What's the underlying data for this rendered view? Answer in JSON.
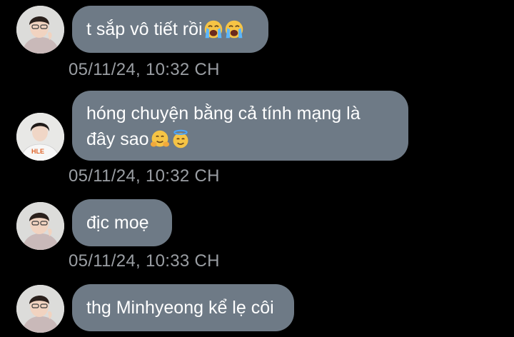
{
  "conversation": {
    "messages": [
      {
        "text": "t sắp vô tiết rồi",
        "emojis": [
          "loudly-crying-face-emoji",
          "loudly-crying-face-emoji"
        ],
        "timestamp": "05/11/24, 10:32 CH"
      },
      {
        "text_line1": "hóng chuyện bằng cả tính mạng là",
        "text_line2": "đây sao",
        "emojis": [
          "hugging-face-emoji",
          "smiling-face-with-halo-emoji"
        ],
        "timestamp": "05/11/24, 10:32 CH",
        "avatar_jersey_text": "HLE"
      },
      {
        "text": "địc moẹ",
        "timestamp": "05/11/24, 10:33 CH"
      },
      {
        "text": "thg Minhyeong kể lẹ côi"
      }
    ]
  },
  "colors": {
    "background": "#000000",
    "bubble": "#6e7a86",
    "bubble_text": "#ffffff",
    "timestamp": "#9a9ea3"
  }
}
